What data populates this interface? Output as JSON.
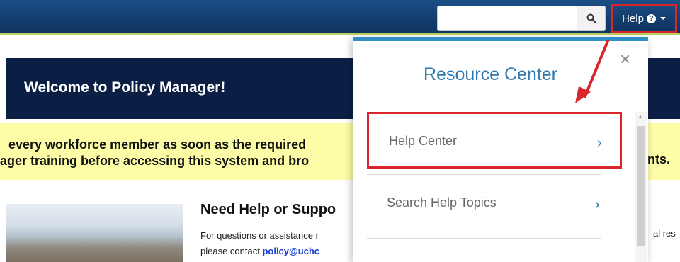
{
  "header": {
    "search_value": "",
    "help_label": "Help",
    "help_badge": "?"
  },
  "welcome": {
    "title": "Welcome to Policy Manager!"
  },
  "notice": {
    "line1": "every workforce member as soon as the required",
    "line2": "ager training before accessing this system and bro",
    "line2_tail": "nts."
  },
  "support": {
    "title": "Need Help or Suppo",
    "line1": "For questions or assistance r",
    "line2_prefix": "please contact ",
    "email": "policy@uchc",
    "right_fragment": "al res"
  },
  "resource_center": {
    "title": "Resource Center",
    "close_label": "×",
    "items": [
      {
        "label": "Help Center",
        "chevron": "›"
      },
      {
        "label": "Search Help Topics",
        "chevron": "›"
      }
    ]
  },
  "colors": {
    "nav": "#143e6e",
    "accent_blue": "#2f7bb0",
    "highlight_red": "#d9262c",
    "notice_yellow": "#fdfda7"
  },
  "icons": {
    "search": "search-icon",
    "help": "question-circle-icon",
    "caret": "caret-down-icon",
    "close": "close-icon",
    "chevron": "chevron-right-icon"
  }
}
